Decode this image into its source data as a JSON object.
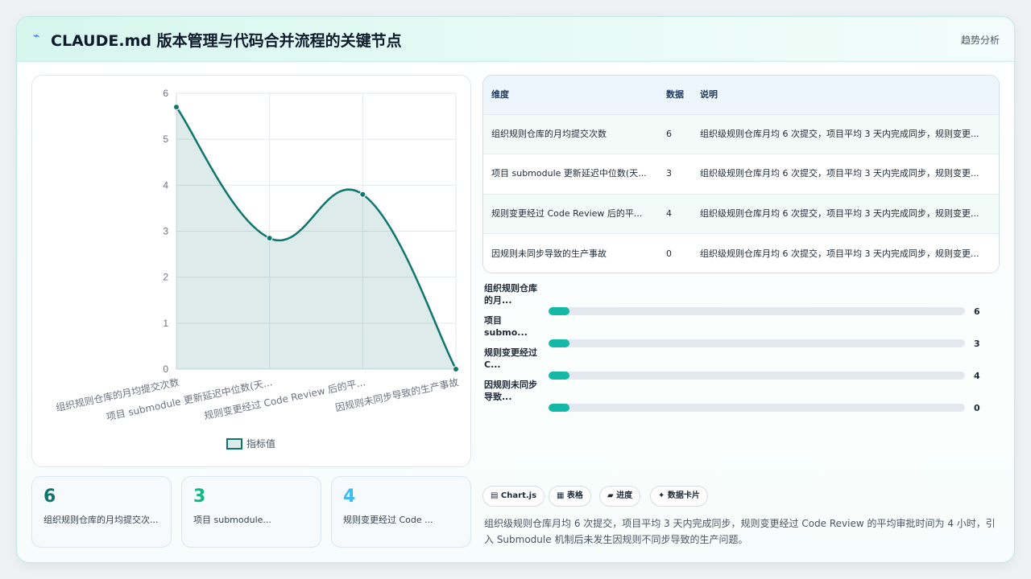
{
  "header": {
    "icon": "chart-line-icon",
    "title": "CLAUDE.md 版本管理与代码合并流程的关键节点",
    "right_label": "趋势分析"
  },
  "chart_data": {
    "type": "line",
    "categories": [
      "组织规则仓库的月均提交次数",
      "项目 submodule 更新延迟中位数(天...",
      "规则变更经过 Code Review 后的平...",
      "因规则未同步导致的生产事故"
    ],
    "series": [
      {
        "name": "指标值",
        "values": [
          5.7,
          2.85,
          3.8,
          0
        ],
        "color": "#0f766e"
      }
    ],
    "y_ticks": [
      "0",
      "1",
      "2",
      "3",
      "4",
      "5",
      "6"
    ],
    "ylim": [
      0,
      6
    ],
    "grid": true,
    "legend_position": "bottom",
    "fill": true
  },
  "table": {
    "headers": [
      "维度",
      "数据",
      "说明"
    ],
    "rows": [
      {
        "name": "组织规则仓库的月均提交次数",
        "value": "6",
        "desc": "组织级规则仓库月均 6 次提交，项目平均 3 天内完成同步，规则变更..."
      },
      {
        "name": "项目 submodule 更新延迟中位数(天...",
        "value": "3",
        "desc": "组织级规则仓库月均 6 次提交，项目平均 3 天内完成同步，规则变更..."
      },
      {
        "name": "规则变更经过 Code Review 后的平...",
        "value": "4",
        "desc": "组织级规则仓库月均 6 次提交，项目平均 3 天内完成同步，规则变更..."
      },
      {
        "name": "因规则未同步导致的生产事故",
        "value": "0",
        "desc": "组织级规则仓库月均 6 次提交，项目平均 3 天内完成同步，规则变更..."
      }
    ]
  },
  "progress": [
    {
      "label": "组织规则仓库的月...",
      "value": "6",
      "fill": 0.05
    },
    {
      "label": "项目 submo...",
      "value": "3",
      "fill": 0.05
    },
    {
      "label": "规则变更经过 C...",
      "value": "4",
      "fill": 0.05
    },
    {
      "label": "因规则未同步导致...",
      "value": "0",
      "fill": 0.05
    }
  ],
  "stats": [
    {
      "value": "6",
      "label": "组织规则仓库的月均提交次...",
      "color": "#0f766e"
    },
    {
      "value": "3",
      "label": "项目 submodule...",
      "color": "#10b981"
    },
    {
      "value": "4",
      "label": "规则变更经过 Code ...",
      "color": "#38bdf8"
    }
  ],
  "tags": [
    {
      "label": "▤ Chart.js",
      "icon": "chart-icon"
    },
    {
      "label": "▦ 表格",
      "icon": "table-icon"
    },
    {
      "label": "▰ 进度",
      "icon": "progress-icon"
    },
    {
      "label": "✦ 数据卡片",
      "icon": "sparkle-icon"
    }
  ],
  "summary": "组织级规则仓库月均 6 次提交，项目平均 3 天内完成同步，规则变更经过 Code Review 的平均审批时间为 4 小时，引入 Submodule 机制后未发生因规则不同步导致的生产问题。"
}
